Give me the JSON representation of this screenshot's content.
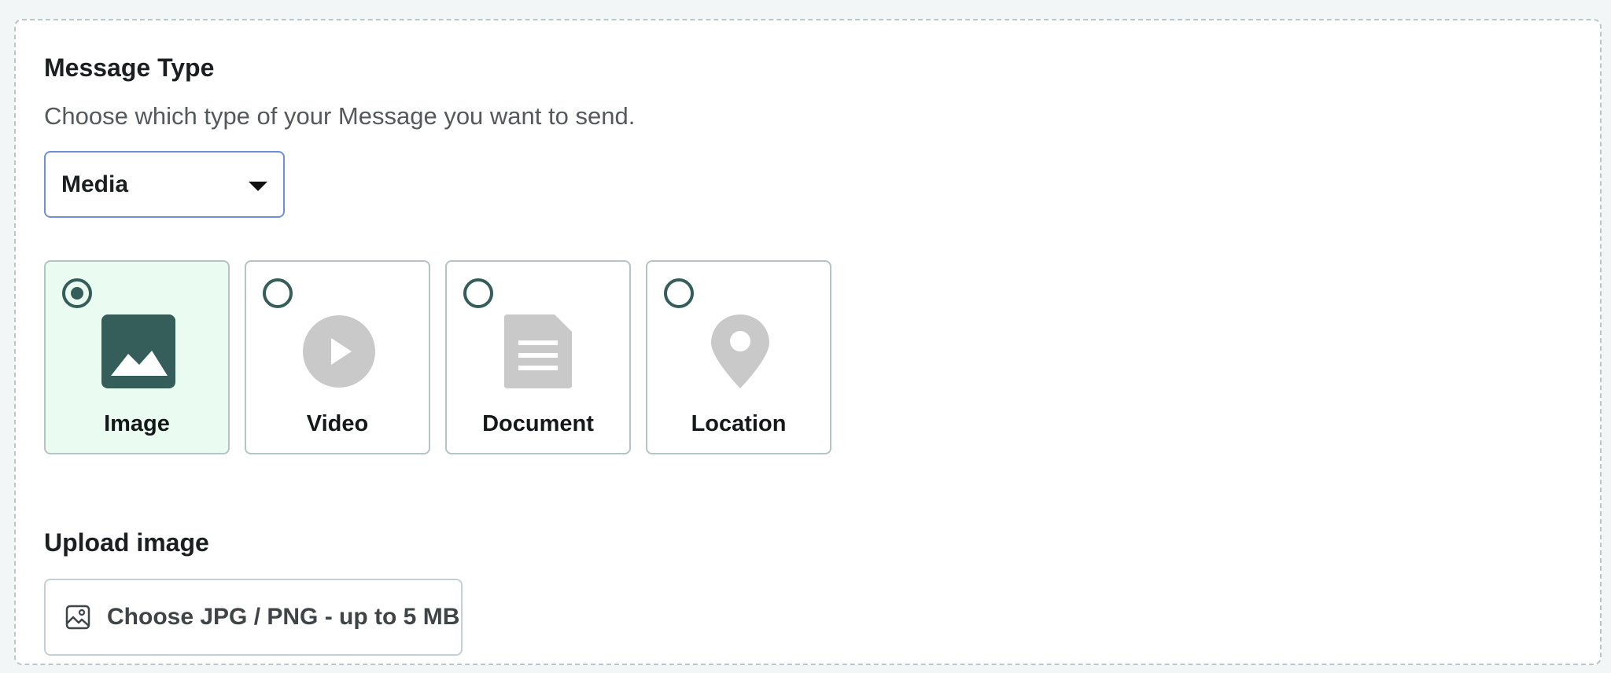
{
  "message_type": {
    "title": "Message Type",
    "subtitle": "Choose which type of your Message you want to send.",
    "select": {
      "value": "Media"
    }
  },
  "media_options": {
    "selected": "Image",
    "items": [
      {
        "label": "Image",
        "icon": "image-icon",
        "checked": true
      },
      {
        "label": "Video",
        "icon": "play-icon",
        "checked": false
      },
      {
        "label": "Document",
        "icon": "document-icon",
        "checked": false
      },
      {
        "label": "Location",
        "icon": "location-pin-icon",
        "checked": false
      }
    ]
  },
  "upload": {
    "title": "Upload image",
    "button_label": "Choose JPG / PNG - up to 5 MB",
    "icon": "image-outline-icon"
  },
  "colors": {
    "accent": "#355e5a",
    "selected_background": "#eafcf1",
    "inactive_icon": "#c9c9c9",
    "select_border": "#6e8fd8"
  }
}
